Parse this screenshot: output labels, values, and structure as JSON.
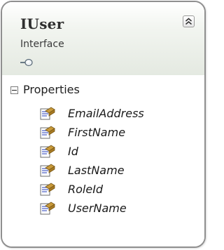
{
  "shape": {
    "name": "IUser",
    "kind": "Interface",
    "icon": "interface-lollipop-icon",
    "collapse_icon": "double-chevron-up-icon"
  },
  "section": {
    "label": "Properties",
    "toggle_icon": "minus-box-icon",
    "state": "expanded"
  },
  "properties": [
    {
      "name": "EmailAddress",
      "icon": "property-icon"
    },
    {
      "name": "FirstName",
      "icon": "property-icon"
    },
    {
      "name": "Id",
      "icon": "property-icon"
    },
    {
      "name": "LastName",
      "icon": "property-icon"
    },
    {
      "name": "RoleId",
      "icon": "property-icon"
    },
    {
      "name": "UserName",
      "icon": "property-icon"
    }
  ],
  "colors": {
    "border": "#8f8f8f",
    "header_gradient_end": "#e4e9e1",
    "text": "#1f1f1f"
  }
}
